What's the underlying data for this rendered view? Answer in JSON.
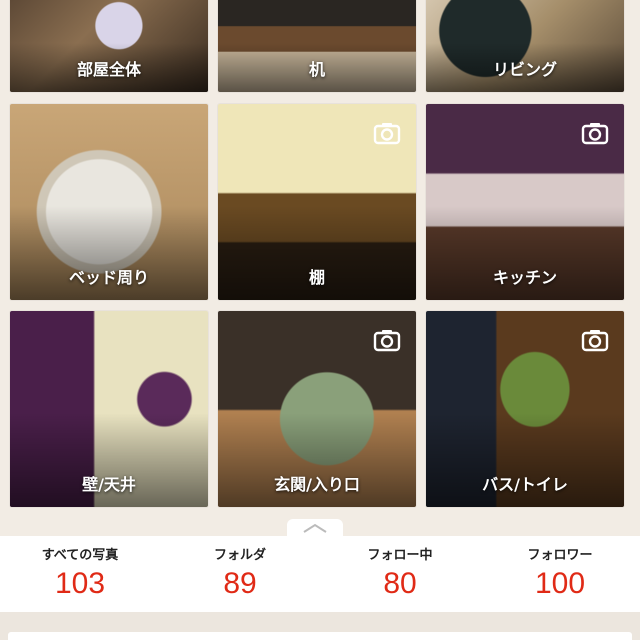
{
  "folders": [
    {
      "label": "部屋全体",
      "camera": false
    },
    {
      "label": "机",
      "camera": false
    },
    {
      "label": "リビング",
      "camera": false
    },
    {
      "label": "ベッド周り",
      "camera": false
    },
    {
      "label": "棚",
      "camera": true
    },
    {
      "label": "キッチン",
      "camera": true
    },
    {
      "label": "壁/天井",
      "camera": false
    },
    {
      "label": "玄関/入り口",
      "camera": true
    },
    {
      "label": "バス/トイレ",
      "camera": true
    }
  ],
  "stats": [
    {
      "label": "すべての写真",
      "value": "103"
    },
    {
      "label": "フォルダ",
      "value": "89"
    },
    {
      "label": "フォロー中",
      "value": "80"
    },
    {
      "label": "フォロワー",
      "value": "100"
    }
  ],
  "colors": {
    "accent": "#e02a16",
    "background": "#f2ece4"
  },
  "icons": {
    "camera": "camera-icon",
    "collapse": "chevron-up-icon"
  }
}
